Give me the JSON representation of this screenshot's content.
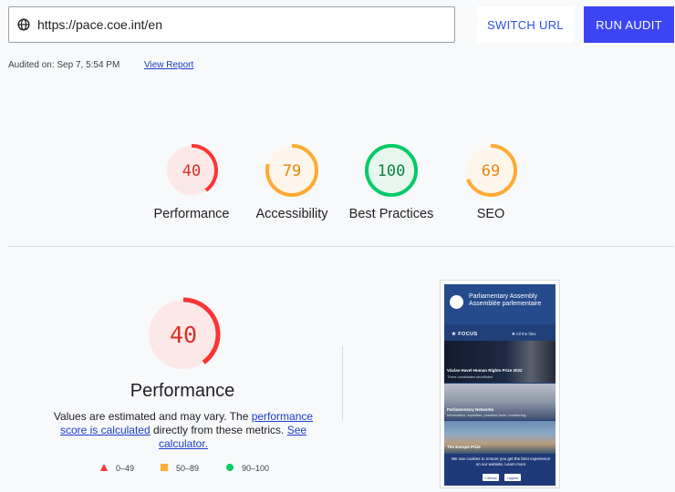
{
  "header": {
    "url": "https://pace.coe.int/en",
    "switch_url_label": "SWITCH URL",
    "run_audit_label": "RUN AUDIT",
    "audited_on": "Audited on: Sep 7, 5:54 PM",
    "view_report_label": "View Report"
  },
  "scores": [
    {
      "label": "Performance",
      "score": "40",
      "value": 40,
      "color": "#f33",
      "fill": "#fde8e8",
      "text_color": "#d93025"
    },
    {
      "label": "Accessibility",
      "score": "79",
      "value": 79,
      "color": "#fa3",
      "fill": "#fef6ea",
      "text_color": "#e8850c"
    },
    {
      "label": "Best Practices",
      "score": "100",
      "value": 100,
      "color": "#0c6",
      "fill": "#e6f8ee",
      "text_color": "#0b8043"
    },
    {
      "label": "SEO",
      "score": "69",
      "value": 69,
      "color": "#fa3",
      "fill": "#fef6ea",
      "text_color": "#e8850c"
    }
  ],
  "detail": {
    "score": "40",
    "value": 40,
    "title": "Performance",
    "desc_prefix": "Values are estimated and may vary. The ",
    "perf_link": "performance score is calculated",
    "desc_middle": " directly from these metrics. ",
    "calc_link": "See calculator.",
    "legend": [
      {
        "label": "0–49",
        "shape": "triangle",
        "color": "#f33"
      },
      {
        "label": "50–89",
        "shape": "square",
        "color": "#fa3"
      },
      {
        "label": "90–100",
        "shape": "circle",
        "color": "#0c6"
      }
    ]
  },
  "screenshot": {
    "site_title": "Parliamentary Assembly Assemblée parlementaire",
    "focus": "★ FOCUS",
    "all_files": "✚ All the files",
    "item1_title": "Václav Havel Human Rights Prize 2022",
    "item1_sub": "Three candidates shortlisted",
    "item2_title": "Parliamentary Networks",
    "item2_sub": "Information, expertise, practical tools, monitoring...",
    "item3_title": "The Europe Prize",
    "cookie_text": "We use cookies to ensure you get the best experience on our website. Learn more",
    "refuse": "I refuse",
    "agree": "I agree"
  }
}
